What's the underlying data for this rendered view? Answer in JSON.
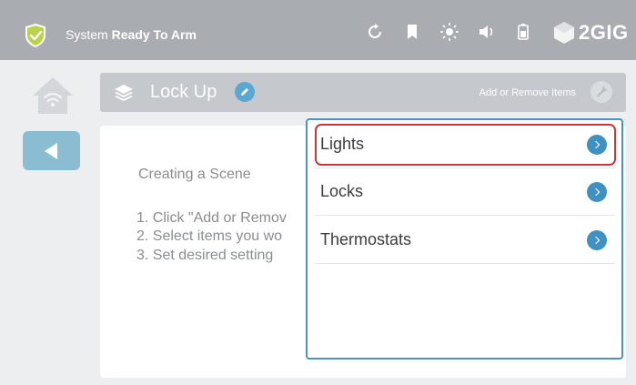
{
  "status_bar": {
    "status_prefix": "System ",
    "status_bold": "Ready To Arm",
    "icons": [
      "refresh-icon",
      "bookmark-icon",
      "brightness-icon",
      "volume-icon",
      "battery-icon"
    ],
    "brand": "2GIG"
  },
  "scene": {
    "title": "Lock Up",
    "add_remove_label": "Add or Remove Items"
  },
  "instructions": {
    "title": "Creating a Scene",
    "steps": [
      "1. Click \"Add or Remov",
      "2. Select items you wo",
      "3. Set desired setting"
    ]
  },
  "dropdown": {
    "items": [
      {
        "label": "Lights",
        "selected": true
      },
      {
        "label": "Locks",
        "selected": false
      },
      {
        "label": "Thermostats",
        "selected": false
      }
    ]
  },
  "colors": {
    "topbar": "#a9acb1",
    "accent_blue": "#3f91c2",
    "selection_red": "#c43a3a",
    "shield_green": "#b8d34a"
  }
}
